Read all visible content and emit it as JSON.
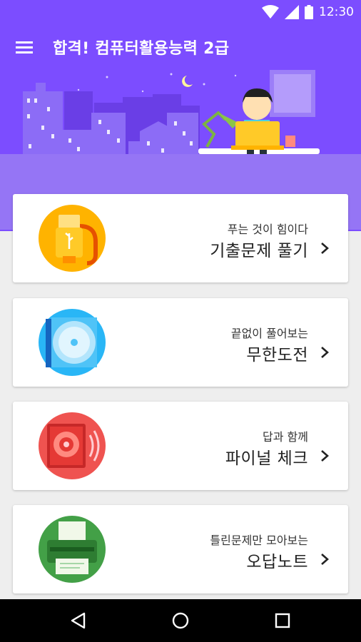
{
  "status_bar": {
    "time": "12:30",
    "icons": [
      "wifi-icon",
      "cell-signal-icon",
      "battery-icon"
    ]
  },
  "app_bar": {
    "title": "합격! 컴퓨터활용능력 2급",
    "menu_icon": "hamburger-menu-icon"
  },
  "colors": {
    "primary": "#7c4dff",
    "hero_lower": "#9575f5",
    "card_bg": "#ffffff",
    "page_bg": "#eeeeee",
    "nav_bg": "#000000"
  },
  "menu_cards": [
    {
      "subtitle": "푸는 것이 힘이다",
      "title": "기출문제 풀기",
      "icon": "usb-drive-icon"
    },
    {
      "subtitle": "끝없이 풀어보는",
      "title": "무한도전",
      "icon": "cd-disc-icon"
    },
    {
      "subtitle": "답과 함께",
      "title": "파이널 체크",
      "icon": "speaker-icon"
    },
    {
      "subtitle": "틀린문제만 모아보는",
      "title": "오답노트",
      "icon": "printer-icon"
    }
  ],
  "nav_bar": {
    "buttons": [
      "back-triangle-icon",
      "home-circle-icon",
      "recent-apps-square-icon"
    ]
  }
}
